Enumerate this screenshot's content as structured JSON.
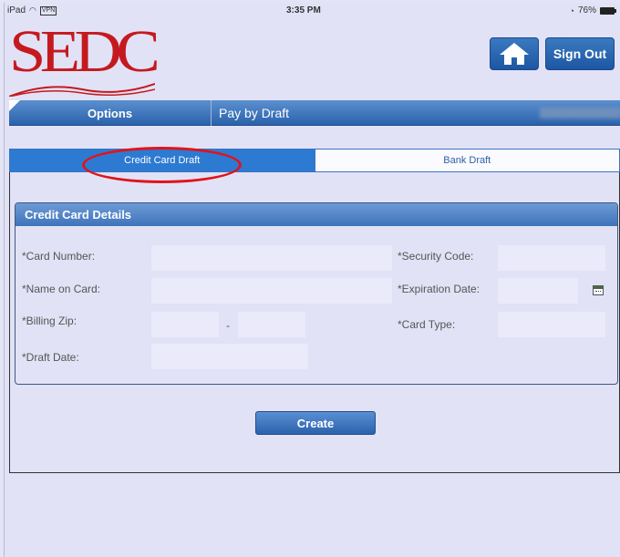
{
  "status_bar": {
    "device": "iPad",
    "vpn": "VPN",
    "time": "3:35 PM",
    "battery": "76%"
  },
  "header": {
    "logo_text": "SEDC",
    "sign_out_label": "Sign Out",
    "home_icon": "home-icon"
  },
  "nav": {
    "options_label": "Options",
    "page_title": "Pay by Draft"
  },
  "tabs": [
    {
      "label": "Credit Card Draft",
      "active": true
    },
    {
      "label": "Bank Draft",
      "active": false
    }
  ],
  "details": {
    "title": "Credit Card Details",
    "card_number_label": "*Card Number:",
    "name_on_card_label": "*Name on Card:",
    "billing_zip_label": "*Billing Zip:",
    "zip_separator": "-",
    "draft_date_label": "*Draft Date:",
    "security_code_label": "*Security Code:",
    "expiration_date_label": "*Expiration Date:",
    "card_type_label": "*Card Type:",
    "card_number_value": "",
    "name_on_card_value": "",
    "billing_zip_value": "",
    "billing_zip_ext_value": "",
    "draft_date_value": "",
    "security_code_value": "",
    "expiration_date_value": "",
    "card_type_value": ""
  },
  "actions": {
    "create_label": "Create"
  },
  "colors": {
    "brand_red": "#c41a1f",
    "nav_blue": "#2a62ab",
    "tab_active": "#2d7ad2",
    "highlight": "#e0141b"
  }
}
